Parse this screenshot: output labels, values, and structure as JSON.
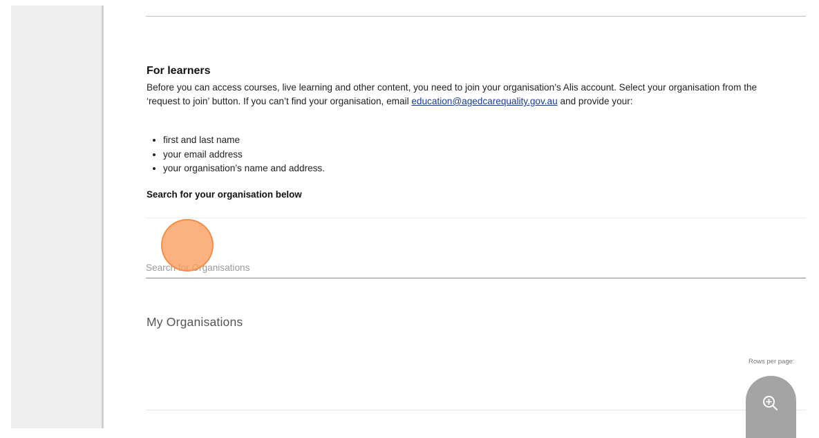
{
  "learners": {
    "heading": "For learners",
    "intro_line1": "Before you can access courses, live learning and other content, you need to join your organisation’s Alis account. Select your organisation from the",
    "intro_line2_before": "‘request to join’ button. If you can’t find your organisation, email ",
    "email_link": "education@agedcarequality.gov.au",
    "intro_line2_after": " and provide your:",
    "bullets": [
      "first and last name",
      "your email address",
      "your organisation’s name and address."
    ],
    "search_heading": "Search for your organisation below"
  },
  "search": {
    "placeholder": "Search for Organisations",
    "value": ""
  },
  "my_organisations": {
    "title": "My Organisations",
    "rows_per_page_label": "Rows per page:"
  },
  "overlay": {
    "click_marker_color": "#f8a46a",
    "zoom_button_icon": "zoom-in-icon",
    "zoom_button_color": "#a4a4a4"
  }
}
